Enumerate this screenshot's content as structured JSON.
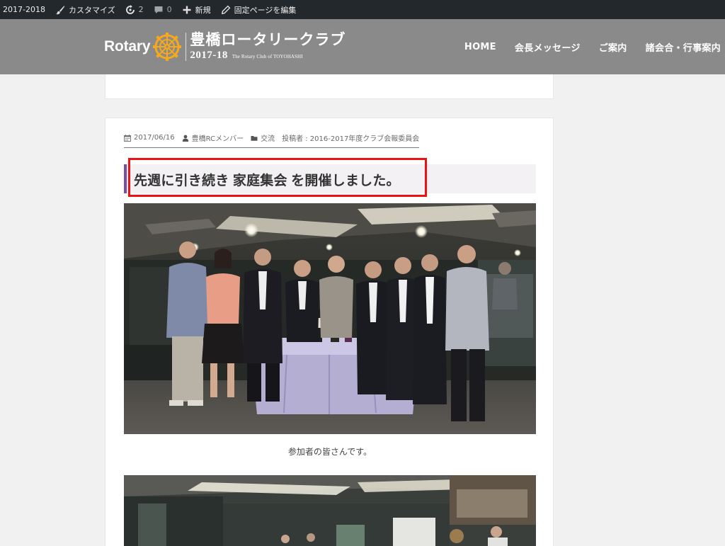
{
  "admin_bar": {
    "site": "2017-2018",
    "customize": "カスタマイズ",
    "updates_count": "2",
    "comments_count": "0",
    "new": "新規",
    "edit_page": "固定ページを編集"
  },
  "header": {
    "brand_rotary": "Rotary",
    "brand_name": "豊橋ロータリークラブ",
    "brand_year": "2017-18",
    "brand_club": "The Rotary Club of TOYOHASHI",
    "nav": [
      "HOME",
      "会長メッセージ",
      "ご案内",
      "諸会合・行事案内"
    ]
  },
  "post": {
    "date": "2017/06/16",
    "author": "豊橋RCメンバー",
    "category": "交流",
    "posted_by": "投稿者 : 2016-2017年度クラブ会報委員会",
    "title": "先週に引き続き 家庭集会 を開催しました。",
    "caption": "参加者の皆さんです。"
  },
  "colors": {
    "admin_bar": "#23282d",
    "header_bg": "#8a8a8a",
    "title_accent": "#7b4f9e",
    "highlight": "#ee1111",
    "rotary_gold": "#f7a81b"
  }
}
